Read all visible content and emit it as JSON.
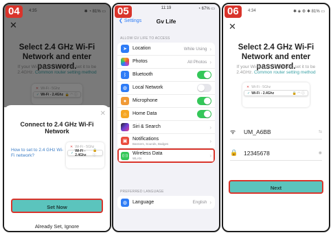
{
  "panel1": {
    "step": "04",
    "time": "4:35",
    "status_icons": "✱ ◔ 81% ▭",
    "title": "Select 2.4 GHz Wi-Fi Network and enter password.",
    "hint": "If your Wi-Fi is 5GHz, please set it to be 2.4GHz.",
    "hint_link": "Common router setting method",
    "mini_wifi_5g": "Wi-Fi - 5Ghz",
    "mini_wifi_24": "Wi-Fi - 2.4Ghz",
    "sheet_title": "Connect to 2.4 GHz Wi-Fi Network",
    "howto": "How to set to 2.4 GHz Wi-Fi network?",
    "set_now": "Set Now",
    "ignore": "Already Set, Ignore"
  },
  "panel2": {
    "step": "05",
    "time": "11:19",
    "status_icons": "◔ 67% ▭",
    "back": "Settings",
    "title": "Gv Life",
    "section1": "ALLOW GV LIFE TO ACCESS",
    "rows": [
      {
        "label": "Location",
        "value": "While Using",
        "color": "#2e7cf6",
        "icon": "➤"
      },
      {
        "label": "Photos",
        "value": "All Photos",
        "color": "#ffffff",
        "icon": "✿"
      },
      {
        "label": "Bluetooth",
        "color": "#2e7cf6",
        "icon": "ᛒ"
      },
      {
        "label": "Local Network",
        "color": "#2e7cf6",
        "icon": "◍"
      },
      {
        "label": "Microphone",
        "color": "#f09a37",
        "icon": "🎙"
      },
      {
        "label": "Home Data",
        "color": "#f5a623",
        "icon": "⌂"
      },
      {
        "label": "Siri & Search",
        "color": "#333333",
        "icon": "◉"
      },
      {
        "label": "Notifications",
        "sub": "Banners, Sounds, Badges",
        "color": "#ea4c3d",
        "icon": "▣"
      },
      {
        "label": "Wireless Data",
        "sub": "WLAN",
        "color": "#34c759",
        "icon": "((·))"
      }
    ],
    "section2": "PREFERRED LANGUAGE",
    "language_label": "Language",
    "language_value": "English"
  },
  "panel3": {
    "step": "06",
    "time": "4:34",
    "status_icons": "✱ ◈ ⚙ ✱ 81% ▭",
    "title": "Select 2.4 GHz Wi-Fi Network and enter password.",
    "hint": "If your Wi-Fi is 5GHz, please set it to be 2.4GHz.",
    "hint_link": "Common router setting method",
    "mini_wifi_5g": "Wi-Fi - 5Ghz",
    "mini_wifi_24": "Wi-Fi - 2.4Ghz",
    "ssid": "UM_A6BB",
    "password": "12345678",
    "next": "Next"
  }
}
